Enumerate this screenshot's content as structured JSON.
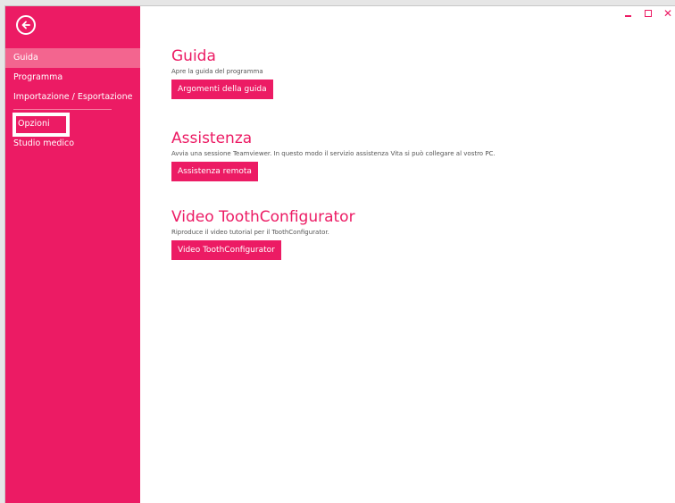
{
  "sidebar": {
    "back_icon": "arrow-left-circle-icon",
    "items": [
      {
        "label": "Guida",
        "active": true
      },
      {
        "label": "Programma"
      },
      {
        "label": "Importazione / Esportazione"
      },
      {
        "label": "Opzioni"
      },
      {
        "label": "Studio medico"
      }
    ]
  },
  "window": {
    "minimize_icon": "minimize-icon",
    "maximize_icon": "maximize-icon",
    "close_label": "✕"
  },
  "sections": [
    {
      "title": "Guida",
      "description": "Apre la guida del programma",
      "button": "Argomenti della guida"
    },
    {
      "title": "Assistenza",
      "description": "Avvia una sessione Teamviewer. In questo modo il servizio assistenza Vita si può collegare al vostro PC.",
      "button": "Assistenza remota"
    },
    {
      "title": "Video ToothConfigurator",
      "description": "Riproduce il video tutorial per il ToothConfigurator.",
      "button": "Video ToothConfigurator"
    }
  ],
  "colors": {
    "accent": "#ec1b64",
    "sidebar_active": "#f3658f",
    "text_muted": "#555555"
  }
}
